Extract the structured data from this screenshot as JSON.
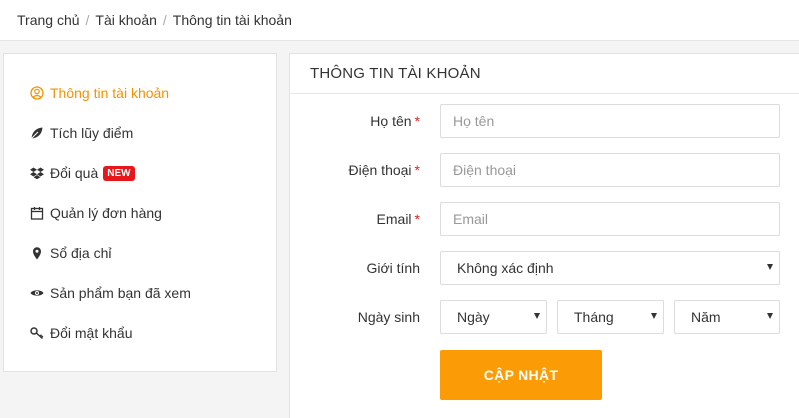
{
  "breadcrumb": {
    "items": [
      "Trang chủ",
      "Tài khoản",
      "Thông tin tài khoản"
    ],
    "separator": "/"
  },
  "sidebar": {
    "items": [
      {
        "label": "Thông tin tài khoản",
        "icon": "user-circle-icon",
        "active": true
      },
      {
        "label": "Tích lũy điểm",
        "icon": "leaf-icon"
      },
      {
        "label": "Đổi quà",
        "icon": "dropbox-icon",
        "badge": "NEW"
      },
      {
        "label": "Quản lý đơn hàng",
        "icon": "calendar-icon"
      },
      {
        "label": "Sổ địa chỉ",
        "icon": "map-marker-icon"
      },
      {
        "label": "Sản phẩm bạn đã xem",
        "icon": "eye-icon"
      },
      {
        "label": "Đổi mật khẩu",
        "icon": "key-icon"
      }
    ]
  },
  "panel": {
    "title": "THÔNG TIN TÀI KHOẢN",
    "fields": {
      "name": {
        "label": "Họ tên",
        "required": "*",
        "placeholder": "Họ tên"
      },
      "phone": {
        "label": "Điện thoại",
        "required": "*",
        "placeholder": "Điện thoại"
      },
      "email": {
        "label": "Email",
        "required": "*",
        "placeholder": "Email"
      },
      "gender": {
        "label": "Giới tính",
        "value": "Không xác định"
      },
      "birthday": {
        "label": "Ngày sinh",
        "day": "Ngày",
        "month": "Tháng",
        "year": "Năm"
      }
    },
    "submit_label": "CẬP NHẬT"
  },
  "colors": {
    "accent": "#f39200",
    "button": "#fb9b06",
    "badge": "#e6161b",
    "required": "#e02020"
  }
}
